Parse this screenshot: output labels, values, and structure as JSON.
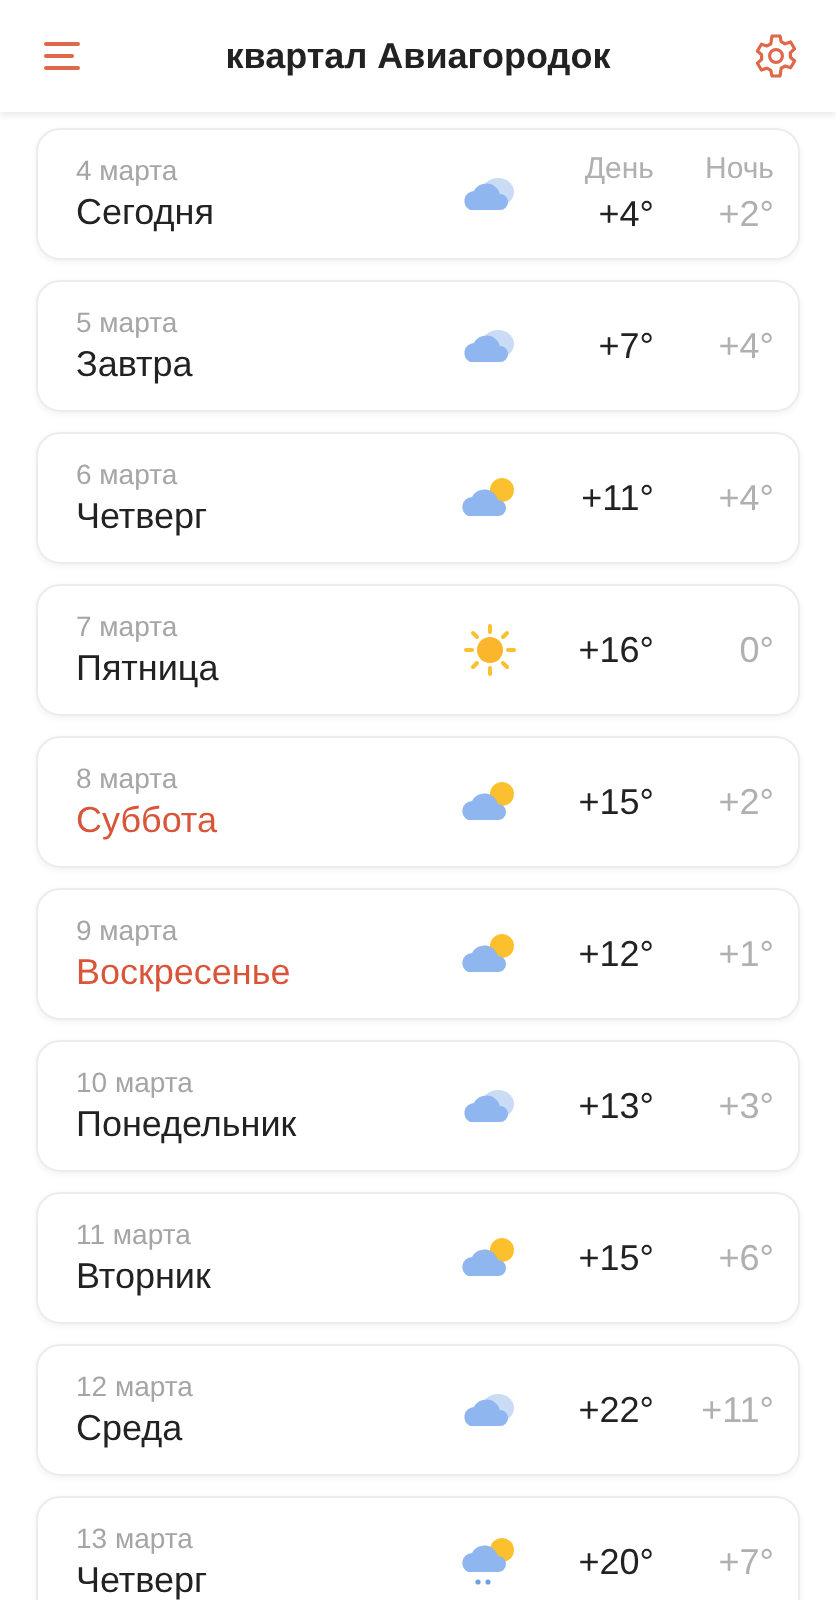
{
  "header": {
    "title": "квартал Авиагородок"
  },
  "days": [
    {
      "date": "4 марта",
      "name": "Сегодня",
      "weekend": false,
      "kind": "overcast",
      "day_label": "День",
      "night_label": "Ночь",
      "day_temp": "+4°",
      "night_temp": "+2°"
    },
    {
      "date": "5 марта",
      "name": "Завтра",
      "weekend": false,
      "kind": "overcast",
      "day_temp": "+7°",
      "night_temp": "+4°"
    },
    {
      "date": "6 марта",
      "name": "Четверг",
      "weekend": false,
      "kind": "partly",
      "day_temp": "+11°",
      "night_temp": "+4°"
    },
    {
      "date": "7 марта",
      "name": "Пятница",
      "weekend": false,
      "kind": "sun",
      "day_temp": "+16°",
      "night_temp": "0°"
    },
    {
      "date": "8 марта",
      "name": "Суббота",
      "weekend": true,
      "kind": "partly",
      "day_temp": "+15°",
      "night_temp": "+2°"
    },
    {
      "date": "9 марта",
      "name": "Воскресенье",
      "weekend": true,
      "kind": "partly",
      "day_temp": "+12°",
      "night_temp": "+1°"
    },
    {
      "date": "10 марта",
      "name": "Понедельник",
      "weekend": false,
      "kind": "overcast",
      "day_temp": "+13°",
      "night_temp": "+3°"
    },
    {
      "date": "11 марта",
      "name": "Вторник",
      "weekend": false,
      "kind": "partly",
      "day_temp": "+15°",
      "night_temp": "+6°"
    },
    {
      "date": "12 марта",
      "name": "Среда",
      "weekend": false,
      "kind": "overcast",
      "day_temp": "+22°",
      "night_temp": "+11°"
    },
    {
      "date": "13 марта",
      "name": "Четверг",
      "weekend": false,
      "kind": "rain",
      "day_temp": "+20°",
      "night_temp": "+7°"
    }
  ]
}
